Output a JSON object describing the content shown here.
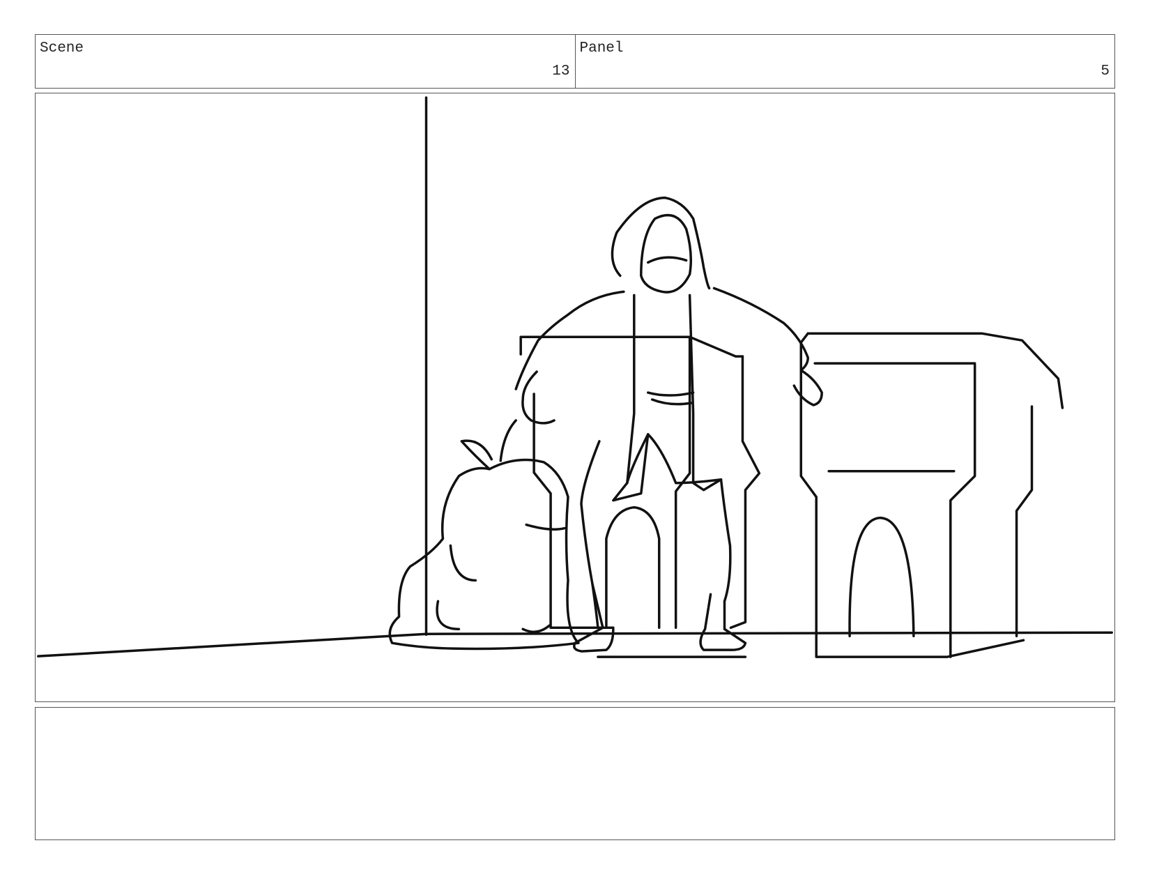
{
  "header": {
    "scene_label": "Scene",
    "scene_number": "13",
    "panel_label": "Panel",
    "panel_number": "5"
  },
  "notes": {
    "text": ""
  }
}
